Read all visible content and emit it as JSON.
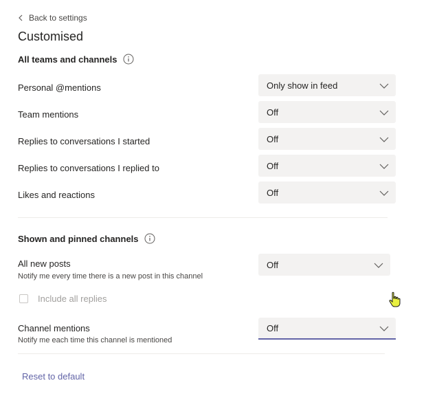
{
  "nav": {
    "back_label": "Back to settings"
  },
  "page": {
    "title": "Customised"
  },
  "all_teams": {
    "title": "All teams and channels",
    "rows": [
      {
        "label": "Personal @mentions",
        "value": "Only show in feed"
      },
      {
        "label": "Team mentions",
        "value": "Off"
      },
      {
        "label": "Replies to conversations I started",
        "value": "Off"
      },
      {
        "label": "Replies to conversations I replied to",
        "value": "Off"
      },
      {
        "label": "Likes and reactions",
        "value": "Off"
      }
    ]
  },
  "shown_pinned": {
    "title": "Shown and pinned channels",
    "all_new_posts": {
      "label": "All new posts",
      "description": "Notify me every time there is a new post in this channel",
      "value": "Off"
    },
    "include_all_replies": {
      "label": "Include all replies",
      "checked": false
    },
    "channel_mentions": {
      "label": "Channel mentions",
      "description": "Notify me each time this channel is mentioned",
      "value": "Off"
    }
  },
  "footer": {
    "reset_label": "Reset to default"
  },
  "colors": {
    "accent": "#6264a7",
    "dropdown_bg": "#f3f2f1",
    "cursor": "#e8f040"
  }
}
